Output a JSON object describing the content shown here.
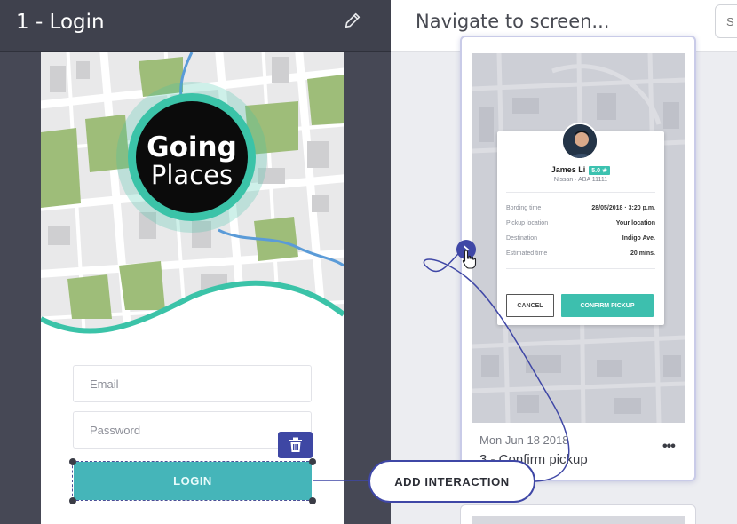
{
  "left_panel": {
    "screen_title": "1 - Login",
    "logo_line1": "Going",
    "logo_line2": "Places",
    "email_placeholder": "Email",
    "password_placeholder": "Password",
    "login_label": "LOGIN"
  },
  "right_panel": {
    "title": "Navigate to screen...",
    "search_placeholder": "S",
    "card": {
      "date": "Mon Jun 18 2018",
      "name": "3 - Confirm pickup",
      "more_label": "•••",
      "driver": {
        "name": "James Li",
        "rating": "5.0 ★",
        "car": "Nissan · ABA 11111",
        "details": [
          {
            "label": "Bording time",
            "value": "28/05/2018 · 3:20 p.m."
          },
          {
            "label": "Pickup location",
            "value": "Your location"
          },
          {
            "label": "Destination",
            "value": "Indigo Ave."
          },
          {
            "label": "Estimated time",
            "value": "20 mins."
          }
        ],
        "cancel_label": "CANCEL",
        "confirm_label": "CONFIRM PICKUP"
      }
    }
  },
  "overlay": {
    "add_interaction_label": "ADD INTERACTION"
  },
  "colors": {
    "accent": "#3f47a6",
    "teal": "#45b5b9",
    "dark_panel": "#464855"
  },
  "icons": {
    "edit": "pencil-icon",
    "delete": "trash-icon",
    "link": "chevron-right-icon",
    "cursor": "hand-pointer-icon",
    "more": "more-horizontal-icon"
  }
}
